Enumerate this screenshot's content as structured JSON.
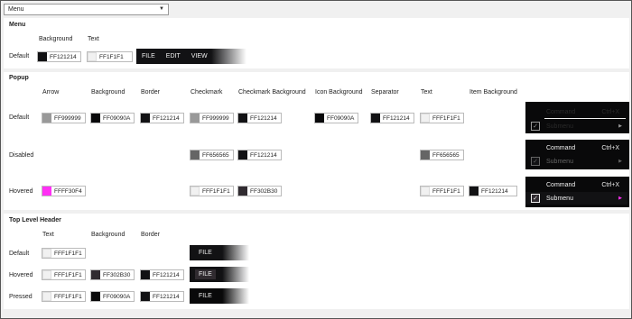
{
  "dropdown": {
    "selected": "Menu"
  },
  "menu": {
    "title": "Menu",
    "col_background": "Background",
    "col_text": "Text",
    "row_default": "Default",
    "bg_value": "FF121214",
    "text_value": "FF1F1F1",
    "bar_items": [
      "FILE",
      "EDIT",
      "VIEW"
    ]
  },
  "popup": {
    "title": "Popup",
    "headers": [
      "Arrow",
      "Background",
      "Border",
      "Checkmark",
      "Checkmark Background",
      "Icon Background",
      "Separator",
      "Text",
      "Item Background"
    ],
    "rows": {
      "default": {
        "label": "Default",
        "arrow": "FF999999",
        "background": "FF09090A",
        "border": "FF121214",
        "checkmark": "FF999999",
        "checkmark_bg": "FF121214",
        "icon_bg": "FF09090A",
        "separator": "FF121214",
        "text": "FFF1F1F1"
      },
      "disabled": {
        "label": "Disabled",
        "checkmark": "FF656565",
        "checkmark_bg": "FF121214",
        "text": "FF656565"
      },
      "hovered": {
        "label": "Hovered",
        "arrow": "FFFF30F4",
        "checkmark": "FFF1F1F1",
        "checkmark_bg": "FF302B30",
        "text": "FFF1F1F1",
        "item_bg": "FF121214"
      }
    },
    "preview": {
      "command": "Command",
      "shortcut": "Ctrl+X",
      "submenu": "Submenu"
    }
  },
  "tlh": {
    "title": "Top Level Header",
    "headers": [
      "Text",
      "Background",
      "Border"
    ],
    "rows": [
      {
        "label": "Default",
        "text": "FFF1F1F1",
        "background": "",
        "border": "",
        "preview": "FILE"
      },
      {
        "label": "Hovered",
        "text": "FFF1F1F1",
        "background": "FF302B30",
        "border": "FF121214",
        "preview": "FILE"
      },
      {
        "label": "Pressed",
        "text": "FFF1F1F1",
        "background": "FF09090A",
        "border": "FF121214",
        "preview": "FILE"
      }
    ]
  },
  "colors": {
    "c121214": "#121214",
    "c09090a": "#09090a",
    "cf1f1f1": "#f1f1f1",
    "c999999": "#999999",
    "c656565": "#656565",
    "cff30f4": "#ff30f4",
    "c302b30": "#302b30"
  }
}
